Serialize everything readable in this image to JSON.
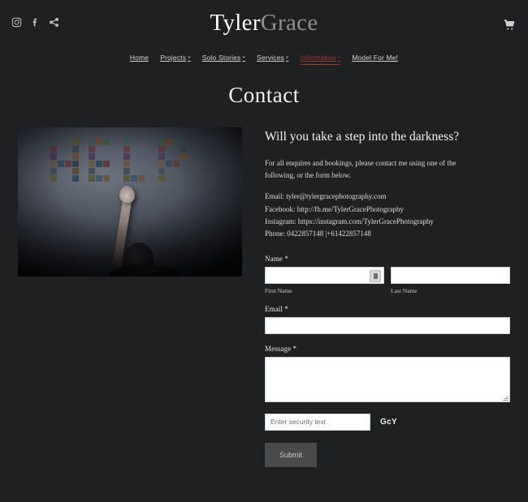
{
  "header": {
    "logo_part1": "Tyler",
    "logo_part2": "Grace",
    "social": [
      {
        "name": "instagram-icon",
        "label": "Instagram"
      },
      {
        "name": "facebook-icon",
        "label": "Facebook"
      },
      {
        "name": "share-icon",
        "label": "Share"
      }
    ],
    "cart_label": "Cart"
  },
  "nav": {
    "items": [
      {
        "label": "Home",
        "caret": "",
        "active": false
      },
      {
        "label": "Projects",
        "caret": "˅",
        "active": false
      },
      {
        "label": "Solo Stories",
        "caret": "˅",
        "active": false
      },
      {
        "label": "Services",
        "caret": "˅",
        "active": false
      },
      {
        "label": "Information",
        "caret": "˅",
        "active": true
      },
      {
        "label": "Model For Me!",
        "caret": "",
        "active": false
      }
    ],
    "active_color": "#9c3a2f"
  },
  "page": {
    "title": "Contact"
  },
  "photo": {
    "alt": "Person reaching toward the word HELP spelled out in photographs on a wall",
    "word": "HELP"
  },
  "main": {
    "heading": "Will you take a step into the darkness?",
    "intro": "For all enquires and bookings, please contact me using one of the following, or the form below.",
    "contact": [
      "Email: tyler@tylergracephotography.com",
      "Facebook: http://fb.me/TylerGracePhotography",
      "Instagram: https://instagram.com/TylerGracePhotography",
      "Phone: 0422857148  |+61422857148"
    ]
  },
  "form": {
    "name_label": "Name *",
    "first_name_value": "",
    "first_name_sublabel": "First Name",
    "last_name_value": "",
    "last_name_sublabel": "Last Name",
    "email_label": "Email *",
    "email_value": "",
    "message_label": "Message *",
    "message_value": "",
    "captcha_placeholder": "Enter security text",
    "captcha_value": "",
    "captcha_code": "GcY",
    "submit_label": "Submit"
  }
}
